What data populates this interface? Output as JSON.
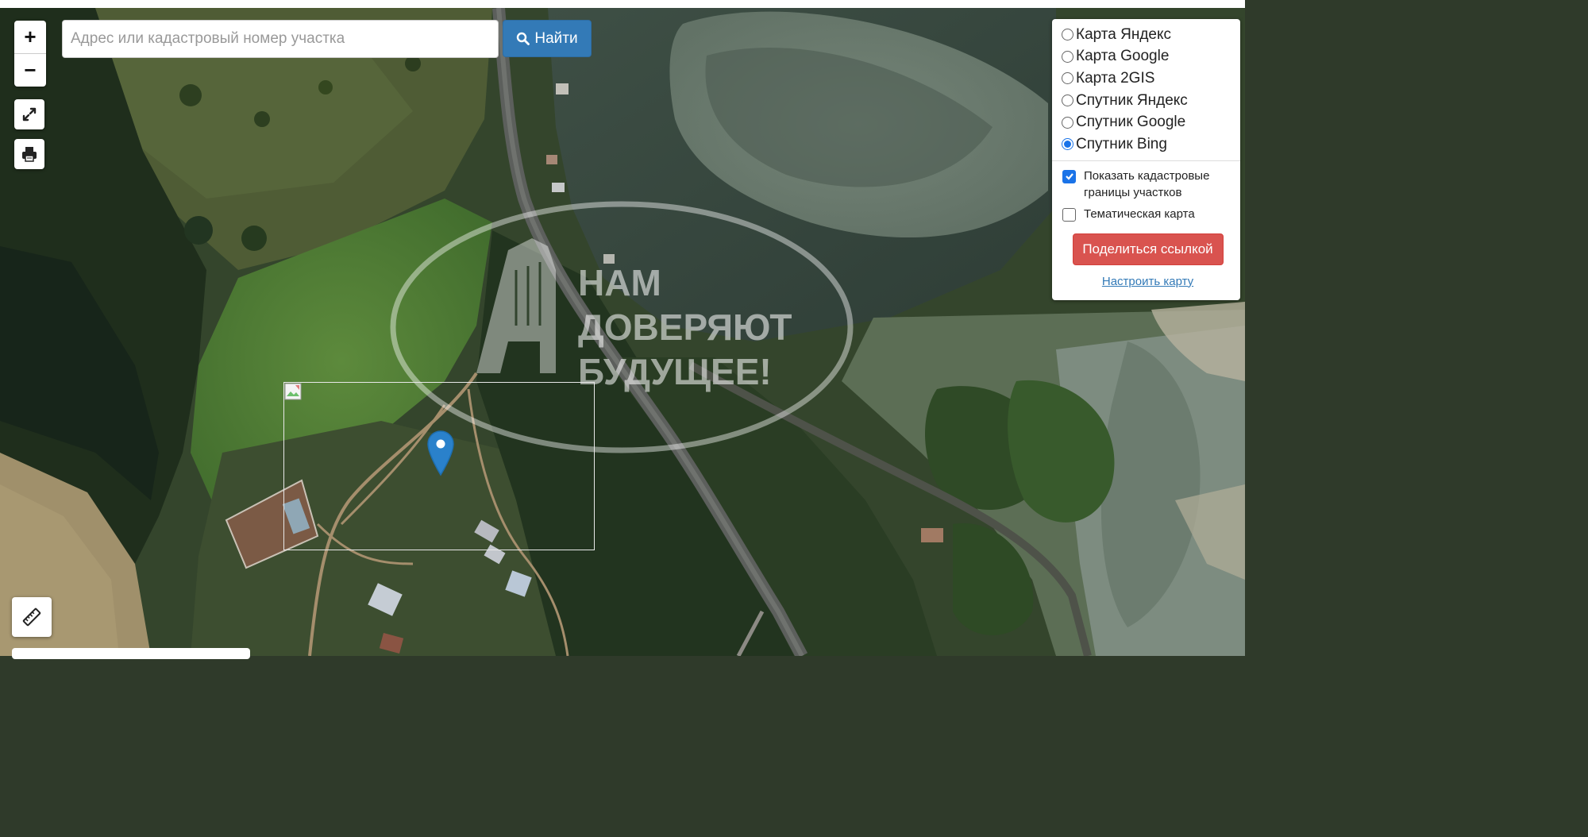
{
  "map": {
    "basemap": "satellite",
    "watermark": {
      "line1": "НАМ",
      "line2": "ДОВЕРЯЮТ",
      "line3": "БУДУЩЕЕ!"
    },
    "marker_icon": "map-pin-icon"
  },
  "controls": {
    "zoom_in": "+",
    "zoom_out": "−",
    "fullscreen_icon": "expand-icon",
    "print_icon": "printer-icon",
    "ruler_icon": "ruler-icon"
  },
  "search": {
    "placeholder": "Адрес или кадастровый номер участка",
    "value": "",
    "button_label": "Найти",
    "button_icon": "search-icon"
  },
  "layers": {
    "selected": "Спутник Bing",
    "options": [
      "Карта Яндекс",
      "Карта Google",
      "Карта 2GIS",
      "Спутник Яндекс",
      "Спутник Google",
      "Спутник Bing"
    ],
    "cadastral_label": "Показать кадастровые границы участков",
    "cadastral_checked": true,
    "thematic_label": "Тематическая карта",
    "thematic_checked": false,
    "share_button": "Поделиться ссылкой",
    "configure_link": "Настроить карту"
  },
  "colors": {
    "primary": "#337ab7",
    "danger": "#d9534f",
    "checkbox": "#1a73e8",
    "marker": "#2a81cb"
  }
}
